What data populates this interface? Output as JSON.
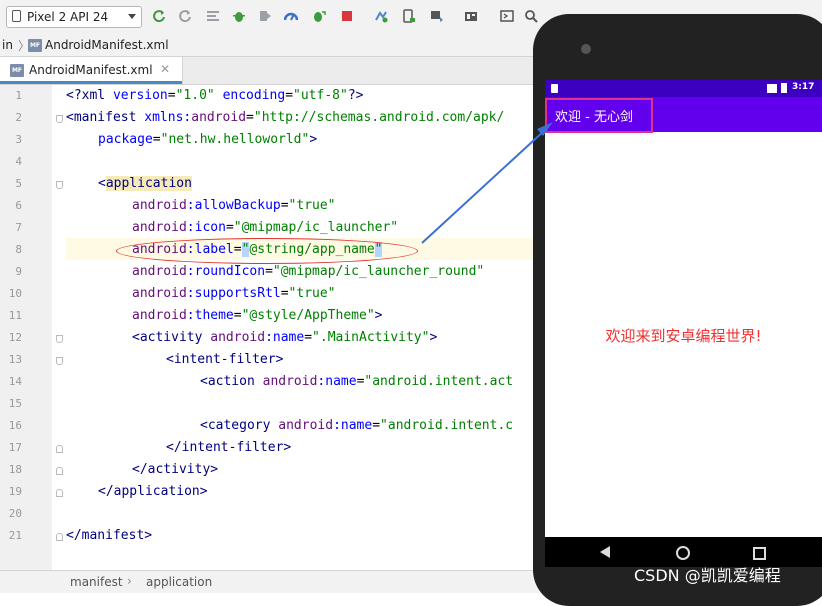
{
  "toolbar": {
    "device": "Pixel 2 API 24",
    "icons": [
      "refresh-icon",
      "apply-changes-icon",
      "layout-icon",
      "debug-bug-icon",
      "profile-icon",
      "performance-icon",
      "attach-debugger-icon",
      "stop-icon",
      "sync-icon",
      "avd-manager-icon",
      "sdk-manager-icon",
      "project-structure-icon",
      "terminal-icon",
      "search-icon"
    ]
  },
  "breadcrumb": {
    "first": "in",
    "file": "AndroidManifest.xml",
    "mf_badge": "MF"
  },
  "tab": {
    "label": "AndroidManifest.xml",
    "close": "✕"
  },
  "editor": {
    "line_numbers": [
      "1",
      "2",
      "3",
      "4",
      "5",
      "6",
      "7",
      "8",
      "9",
      "10",
      "11",
      "12",
      "13",
      "14",
      "15",
      "16",
      "17",
      "18",
      "19",
      "20",
      "21"
    ],
    "l1": {
      "a": "<?xml ",
      "b": "version",
      "c": "=",
      "d": "\"1.0\"",
      "e": " ",
      "f": "encoding",
      "g": "=",
      "h": "\"utf-8\"",
      "i": "?>"
    },
    "l2": {
      "a": "<manifest ",
      "b": "xmlns:",
      "c": "android",
      "d": "=",
      "e": "\"http://schemas.android.com/apk/"
    },
    "l3": {
      "a": "package",
      "b": "=",
      "c": "\"net.hw.helloworld\"",
      "d": ">"
    },
    "l5": {
      "a": "<",
      "b": "application"
    },
    "l6": {
      "ns": "android",
      ":": ":",
      "attr": "allowBackup",
      "eq": "=",
      "val": "\"true\""
    },
    "l7": {
      "ns": "android",
      ":": ":",
      "attr": "icon",
      "eq": "=",
      "val": "\"@mipmap/ic_launcher\""
    },
    "l8": {
      "ns": "android",
      ":": ":",
      "attr": "label",
      "eq": "=",
      "q1": "\"",
      "val": "@string/app_name",
      "q2": "\""
    },
    "l9": {
      "ns": "android",
      ":": ":",
      "attr": "roundIcon",
      "eq": "=",
      "val": "\"@mipmap/ic_launcher_round\""
    },
    "l10": {
      "ns": "android",
      ":": ":",
      "attr": "supportsRtl",
      "eq": "=",
      "val": "\"true\""
    },
    "l11": {
      "ns": "android",
      ":": ":",
      "attr": "theme",
      "eq": "=",
      "val": "\"@style/AppTheme\"",
      "end": ">"
    },
    "l12": {
      "a": "<activity ",
      "ns": "android",
      ":": ":",
      "attr": "name",
      "eq": "=",
      "val": "\".MainActivity\"",
      "end": ">"
    },
    "l13": {
      "a": "<intent-filter>"
    },
    "l14": {
      "a": "<action ",
      "ns": "android",
      ":": ":",
      "attr": "name",
      "eq": "=",
      "val": "\"android.intent.act"
    },
    "l16": {
      "a": "<category ",
      "ns": "android",
      ":": ":",
      "attr": "name",
      "eq": "=",
      "val": "\"android.intent.c"
    },
    "l17": {
      "a": "</intent-filter>"
    },
    "l18": {
      "a": "</activity>"
    },
    "l19": {
      "a": "</application>"
    },
    "l21": {
      "a": "</manifest>"
    }
  },
  "statusbar": {
    "crumb1": "manifest",
    "sep": "›",
    "crumb2": "application"
  },
  "emulator": {
    "time": "3:17",
    "app_title": "欢迎 - 无心剑",
    "hello_text": "欢迎来到安卓编程世界!",
    "colors": {
      "status_bar": "#3b00c0",
      "action_bar": "#6200ee",
      "hello_text": "#f03030"
    }
  },
  "watermark": "CSDN @凯凯爱编程"
}
